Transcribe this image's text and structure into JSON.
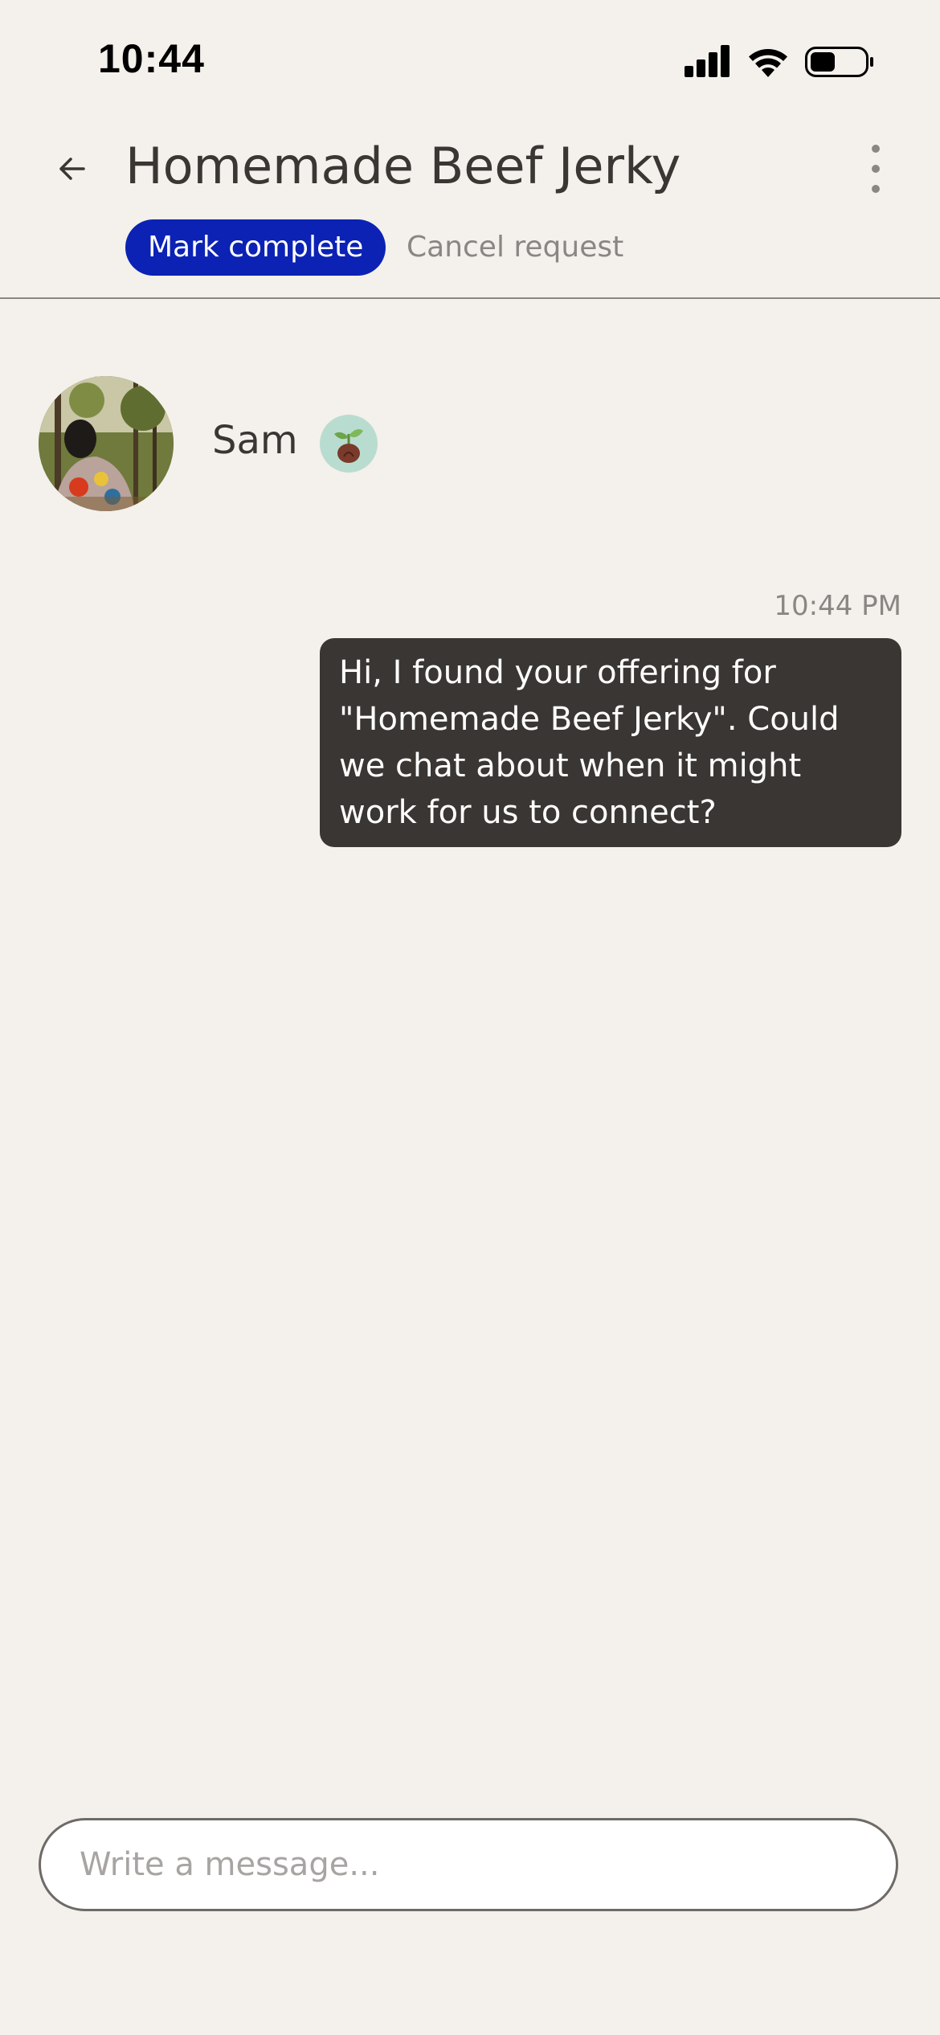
{
  "status_bar": {
    "time": "10:44",
    "icons": [
      "cellular-signal-icon",
      "wifi-icon",
      "battery-icon"
    ]
  },
  "header": {
    "title": "Homemade Beef Jerky",
    "back_icon": "arrow-left-icon",
    "more_icon": "more-vertical-icon",
    "mark_complete_label": "Mark complete",
    "cancel_request_label": "Cancel request"
  },
  "contact": {
    "name": "Sam",
    "badge_icon": "seedling-icon"
  },
  "messages": [
    {
      "time": "10:44 PM",
      "text": "Hi, I found your offering for \"Homemade Beef Jerky\". Could we chat about when it might work for us to connect?",
      "sender": "me"
    }
  ],
  "composer": {
    "placeholder": "Write a message...",
    "value": ""
  },
  "colors": {
    "background": "#f4f0eb",
    "primary_button": "#0b22b5",
    "bubble": "#3a3633",
    "muted_text": "#8a8684",
    "badge": "#b8ddd0"
  }
}
